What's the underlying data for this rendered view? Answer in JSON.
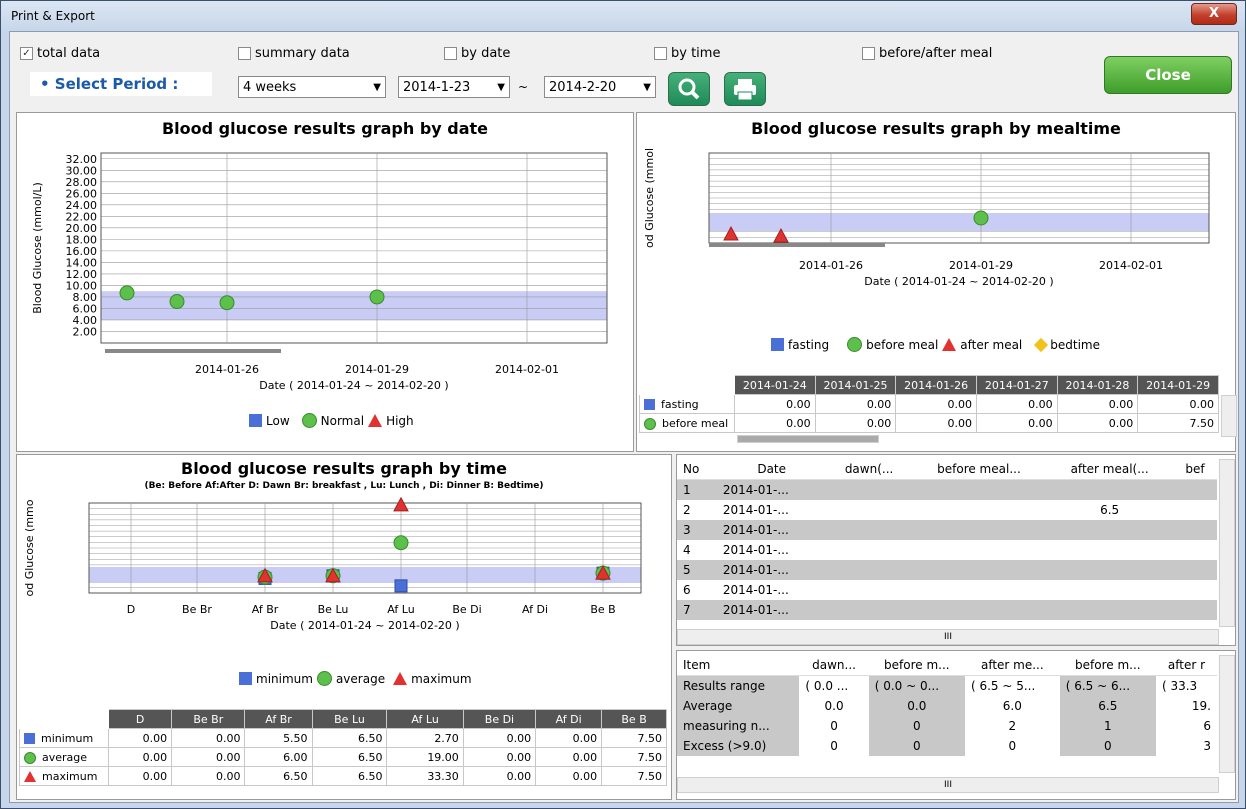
{
  "window": {
    "title": "Print & Export",
    "close_glyph": "X"
  },
  "filters": {
    "total": "total data",
    "summary": "summary data",
    "by_date": "by date",
    "by_time": "by time",
    "meal": "before/after meal",
    "check": "✓"
  },
  "period": {
    "label": "• Select Period :",
    "range": "4 weeks",
    "from": "2014-1-23 ",
    "to": "2014-2-20 ",
    "tilde": "~",
    "arrow": "▼"
  },
  "buttons": {
    "close": "Close",
    "search_icon": "search-icon",
    "print_icon": "print-icon"
  },
  "colors": {
    "target_band": "#c9ccf5",
    "low": "#4a6fd6",
    "normal": "#5cc04a",
    "high": "#e0332f",
    "bedtime": "#f3c21a",
    "header_bg": "#555555"
  },
  "graph_date": {
    "title": "Blood glucose results graph by date",
    "ylabel": "Blood Glucose (mmol/L)",
    "xlabel": "Date ( 2014-01-24 ~ 2014-02-20 )",
    "yticks": [
      "32.00",
      "30.00",
      "28.00",
      "26.00",
      "24.00",
      "22.00",
      "20.00",
      "18.00",
      "16.00",
      "14.00",
      "12.00",
      "10.00",
      "8.00",
      "6.00",
      "4.00",
      "2.00"
    ],
    "xticks": [
      "2014-01-26",
      "2014-01-29",
      "2014-02-01"
    ],
    "legend": {
      "low": "Low",
      "normal": "Normal",
      "high": "High"
    }
  },
  "graph_meal": {
    "title": "Blood glucose results graph by mealtime",
    "ylabel": "od Glucose (mmol",
    "xlabel": "Date ( 2014-01-24 ~ 2014-02-20 )",
    "xticks": [
      "2014-01-26",
      "2014-01-29",
      "2014-02-01"
    ],
    "legend": {
      "fasting": "fasting",
      "before": "before meal",
      "after": "after meal",
      "bedtime": "bedtime"
    },
    "table": {
      "headers": [
        "2014-01-24",
        "2014-01-25",
        "2014-01-26",
        "2014-01-27",
        "2014-01-28",
        "2014-01-29"
      ],
      "rows": [
        {
          "label": "fasting",
          "values": [
            "0.00",
            "0.00",
            "0.00",
            "0.00",
            "0.00",
            "0.00"
          ]
        },
        {
          "label": "before meal",
          "values": [
            "0.00",
            "0.00",
            "0.00",
            "0.00",
            "0.00",
            "7.50"
          ]
        }
      ]
    }
  },
  "graph_time": {
    "title": "Blood glucose results graph by time",
    "subtitle": "(Be: Before Af:After D: Dawn Br: breakfast , Lu: Lunch , Di: Dinner B: Bedtime)",
    "ylabel": "od Glucose (mmo",
    "xlabel": "Date ( 2014-01-24 ~ 2014-02-20 )",
    "xticks": [
      "D",
      "Be Br",
      "Af Br",
      "Be Lu",
      "Af Lu",
      "Be Di",
      "Af Di",
      "Be B"
    ],
    "legend": {
      "min": "minimum",
      "avg": "average",
      "max": "maximum"
    },
    "table": {
      "headers": [
        "D",
        "Be Br",
        "Af Br",
        "Be Lu",
        "Af Lu",
        "Be Di",
        "Af Di",
        "Be B"
      ],
      "rows": [
        {
          "label": "minimum",
          "values": [
            "0.00",
            "0.00",
            "5.50",
            "6.50",
            "2.70",
            "0.00",
            "0.00",
            "7.50"
          ]
        },
        {
          "label": "average",
          "values": [
            "0.00",
            "0.00",
            "6.00",
            "6.50",
            "19.00",
            "0.00",
            "0.00",
            "7.50"
          ]
        },
        {
          "label": "maximum",
          "values": [
            "0.00",
            "0.00",
            "6.50",
            "6.50",
            "33.30",
            "0.00",
            "0.00",
            "7.50"
          ]
        }
      ]
    }
  },
  "records": {
    "headers": [
      "No",
      "Date",
      "dawn(...",
      "before meal...",
      "after meal(...",
      "bef"
    ],
    "rows": [
      {
        "no": "1",
        "date": "2014-01-...",
        "after": ""
      },
      {
        "no": "2",
        "date": "2014-01-...",
        "after": "6.5"
      },
      {
        "no": "3",
        "date": "2014-01-...",
        "after": ""
      },
      {
        "no": "4",
        "date": "2014-01-...",
        "after": ""
      },
      {
        "no": "5",
        "date": "2014-01-...",
        "after": ""
      },
      {
        "no": "6",
        "date": "2014-01-...",
        "after": ""
      },
      {
        "no": "7",
        "date": "2014-01-...",
        "after": ""
      }
    ],
    "scroll_glyph": "III"
  },
  "summary": {
    "headers": [
      "Item",
      "dawn...",
      "before m...",
      "after me...",
      "before m...",
      "after r"
    ],
    "rows": [
      {
        "item": "Results range",
        "c1": "( 0.0 ...",
        "c2": "( 0.0 ~ 0...",
        "c3": "( 6.5 ~ 5...",
        "c4": "( 6.5 ~ 6...",
        "c5": "( 33.3"
      },
      {
        "item": "Average",
        "c1": "0.0",
        "c2": "0.0",
        "c3": "6.0",
        "c4": "6.5",
        "c5": "19."
      },
      {
        "item": "measuring n...",
        "c1": "0",
        "c2": "0",
        "c3": "2",
        "c4": "1",
        "c5": "6"
      },
      {
        "item": "Excess (>9.0)",
        "c1": "0",
        "c2": "0",
        "c3": "0",
        "c4": "0",
        "c5": "3"
      }
    ]
  }
}
